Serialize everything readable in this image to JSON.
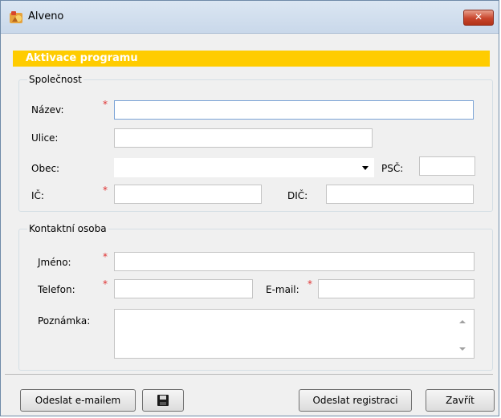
{
  "window": {
    "title": "Alveno",
    "close_glyph": "✕"
  },
  "banner": "Aktivace programu",
  "company": {
    "legend": "Společnost",
    "nazev_label": "Název:",
    "ulice_label": "Ulice:",
    "obec_label": "Obec:",
    "psc_label": "PSČ:",
    "ic_label": "IČ:",
    "dic_label": "DIČ:",
    "required_mark": "*",
    "nazev_value": "",
    "ulice_value": "",
    "obec_value": "",
    "psc_value": "",
    "ic_value": "",
    "dic_value": ""
  },
  "contact": {
    "legend": "Kontaktní osoba",
    "jmeno_label": "Jméno:",
    "telefon_label": "Telefon:",
    "email_label": "E-mail:",
    "poznamka_label": "Poznámka:",
    "required_mark": "*",
    "jmeno_value": "",
    "telefon_value": "",
    "email_value": "",
    "poznamka_value": ""
  },
  "buttons": {
    "send_email": "Odeslat e-mailem",
    "save_icon": "floppy-disk-icon",
    "send_registration": "Odeslat registraci",
    "close": "Zavřít"
  },
  "colors": {
    "banner": "#ffcc00",
    "required": "#e03030",
    "focus": "#7aa3d6"
  }
}
